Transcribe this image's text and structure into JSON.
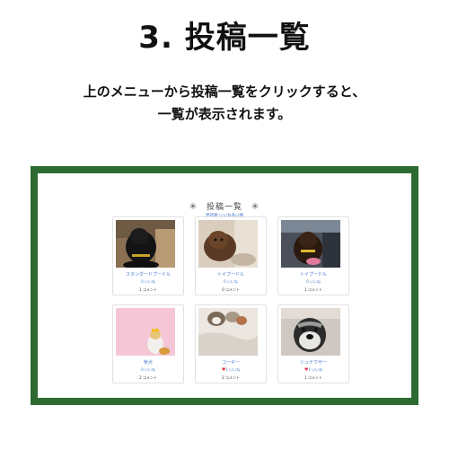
{
  "step_title": "3. 投稿一覧",
  "description": {
    "line1": "上のメニューから投稿一覧をクリックすると、",
    "line2": "一覧が表示されます。"
  },
  "screen": {
    "heading": "投稿一覧",
    "heading_star": "✳",
    "sort_link": "更新順 いいね多い順",
    "posts": [
      {
        "breed": "スタンダードプードル",
        "likes": "0 いいね",
        "liked": false,
        "comments": "1 コメント",
        "photo": "black-poodle-photo"
      },
      {
        "breed": "トイプードル",
        "likes": "0 いいね",
        "liked": false,
        "comments": "0 コメント",
        "photo": "brown-toy-poodle-photo"
      },
      {
        "breed": "トイプードル",
        "likes": "0 いいね",
        "liked": false,
        "comments": "1 コメント",
        "photo": "toy-poodle-car-photo"
      },
      {
        "breed": "柴犬",
        "likes": "0 いいね",
        "liked": false,
        "comments": "2 コメント",
        "photo": "shiba-pink-photo"
      },
      {
        "breed": "コーギー",
        "likes": "1 いいね",
        "liked": true,
        "comments": "2 コメント",
        "photo": "corgi-puppy-photo"
      },
      {
        "breed": "シュナウザー",
        "likes": "1 いいね",
        "liked": true,
        "comments": "1 コメント",
        "photo": "schnauzer-photo"
      }
    ]
  },
  "colors": {
    "frame": "#2d6a31",
    "link": "#4a7bd0",
    "heart": "#e0344b"
  }
}
